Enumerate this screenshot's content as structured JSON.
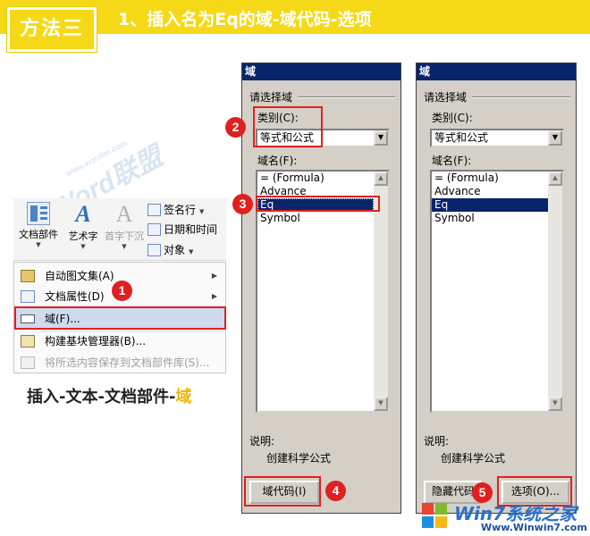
{
  "header": {
    "badge": "方法三",
    "title": "1、插入名为Eq的域-域代码-选项"
  },
  "watermarks": {
    "brand": "Word联盟",
    "url": "www.wordlm.com"
  },
  "ribbon": {
    "doc_parts": "文档部件",
    "art_text": "艺术字",
    "drop_cap": "首字下沉",
    "signature": "签名行",
    "datetime": "日期和时间",
    "object": "对象"
  },
  "menu": {
    "items": [
      {
        "label": "自动图文集(A)"
      },
      {
        "label": "文档属性(D)"
      },
      {
        "label": "域(F)..."
      },
      {
        "label": "构建基块管理器(B)..."
      },
      {
        "label": "将所选内容保存到文档部件库(S)..."
      }
    ]
  },
  "caption": {
    "main": "插入-文本-文档部件-",
    "highlight": "域"
  },
  "dialog_left": {
    "title": "域",
    "group": "请选择域",
    "category_label": "类别(C):",
    "category_value": "等式和公式",
    "fieldname_label": "域名(F):",
    "fields": [
      "= (Formula)",
      "Advance",
      "Eq",
      "Symbol"
    ],
    "selected_index": 2,
    "desc_label": "说明:",
    "desc_text": "创建科学公式",
    "field_codes_button": "域代码(I)"
  },
  "dialog_right": {
    "title": "域",
    "group": "请选择域",
    "category_label": "类别(C):",
    "category_value": "等式和公式",
    "fieldname_label": "域名(F):",
    "fields": [
      "= (Formula)",
      "Advance",
      "Eq",
      "Symbol"
    ],
    "selected_index": 2,
    "desc_label": "说明:",
    "desc_text": "创建科学公式",
    "hide_codes_button": "隐藏代码",
    "options_button": "选项(O)..."
  },
  "badges": [
    "1",
    "2",
    "3",
    "4",
    "5"
  ],
  "logo": {
    "name": "Win7系统之家",
    "url": "Www.Winwin7.com"
  },
  "colors": {
    "accent_yellow": "#f5d916",
    "callout_red": "#e02020",
    "selection_navy": "#0a246a",
    "dialog_gray": "#d4d0c8"
  }
}
